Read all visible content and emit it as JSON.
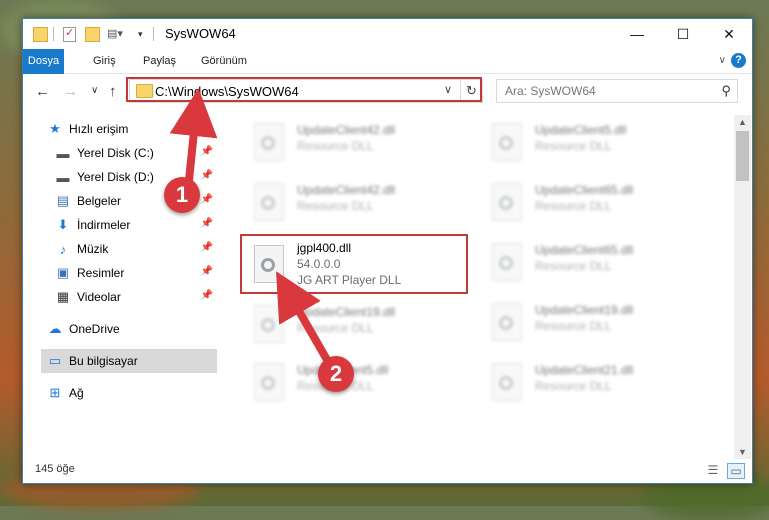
{
  "window": {
    "title": "SysWOW64",
    "controls": {
      "minimize": "—",
      "maximize": "☐",
      "close": "✕"
    }
  },
  "ribbon": {
    "tabs": [
      "Dosya",
      "Giriş",
      "Paylaş",
      "Görünüm"
    ],
    "toggle": "∨",
    "help": "?"
  },
  "address": {
    "path": "C:\\Windows\\SysWOW64",
    "dropdown": "∨",
    "refresh": "↻"
  },
  "search": {
    "placeholder": "Ara: SysWOW64"
  },
  "nav": {
    "back": "←",
    "forward": "→",
    "recent": "∨",
    "up": "↑"
  },
  "sidebar": {
    "items": [
      {
        "label": "Hızlı erişim",
        "icon": "star-icon",
        "glyph": "★",
        "color": "#1e78d6"
      },
      {
        "label": "Yerel Disk (C:)",
        "icon": "disk-icon",
        "glyph": "▬",
        "color": "#555555"
      },
      {
        "label": "Yerel Disk (D:)",
        "icon": "disk-icon",
        "glyph": "▬",
        "color": "#555555"
      },
      {
        "label": "Belgeler",
        "icon": "documents-icon",
        "glyph": "▤",
        "color": "#3a72b8"
      },
      {
        "label": "İndirmeler",
        "icon": "download-icon",
        "glyph": "⬇",
        "color": "#1e78d6"
      },
      {
        "label": "Müzik",
        "icon": "music-icon",
        "glyph": "♪",
        "color": "#1e78d6"
      },
      {
        "label": "Resimler",
        "icon": "pictures-icon",
        "glyph": "▣",
        "color": "#3a72b8"
      },
      {
        "label": "Videolar",
        "icon": "video-icon",
        "glyph": "▦",
        "color": "#333333"
      },
      {
        "label": "OneDrive",
        "icon": "cloud-icon",
        "glyph": "☁",
        "color": "#1e78d6"
      },
      {
        "label": "Bu bilgisayar",
        "icon": "computer-icon",
        "glyph": "▭",
        "color": "#1e78d6"
      },
      {
        "label": "Ağ",
        "icon": "network-icon",
        "glyph": "⊞",
        "color": "#1e78d6"
      }
    ],
    "pin": "📌"
  },
  "files": {
    "left": [
      {
        "name": "UpdateClient42.dll",
        "desc": "Resource DLL"
      },
      {
        "name": "UpdateClient42.dll",
        "desc": "Resource DLL"
      },
      {
        "name": "jgpl400.dll",
        "version": "54.0.0.0",
        "desc": "JG ART Player DLL"
      },
      {
        "name": "UpdateClient19.dll",
        "desc": "Resource DLL"
      },
      {
        "name": "UpdateClient5.dll",
        "desc": "Resource DLL"
      }
    ],
    "right": [
      {
        "name": "UpdateClient5.dll",
        "desc": "Resource DLL"
      },
      {
        "name": "UpdateClient65.dll",
        "desc": "Resource DLL"
      },
      {
        "name": "UpdateClient65.dll",
        "desc": "Resource DLL"
      },
      {
        "name": "UpdateClient19.dll",
        "desc": "Resource DLL"
      },
      {
        "name": "UpdateClient21.dll",
        "desc": "Resource DLL"
      }
    ]
  },
  "status": {
    "count": "145 öğe"
  },
  "callouts": {
    "one": "1",
    "two": "2"
  },
  "colors": {
    "accent": "#1979ca",
    "highlight": "#c3383b",
    "callout": "#d9393d"
  }
}
